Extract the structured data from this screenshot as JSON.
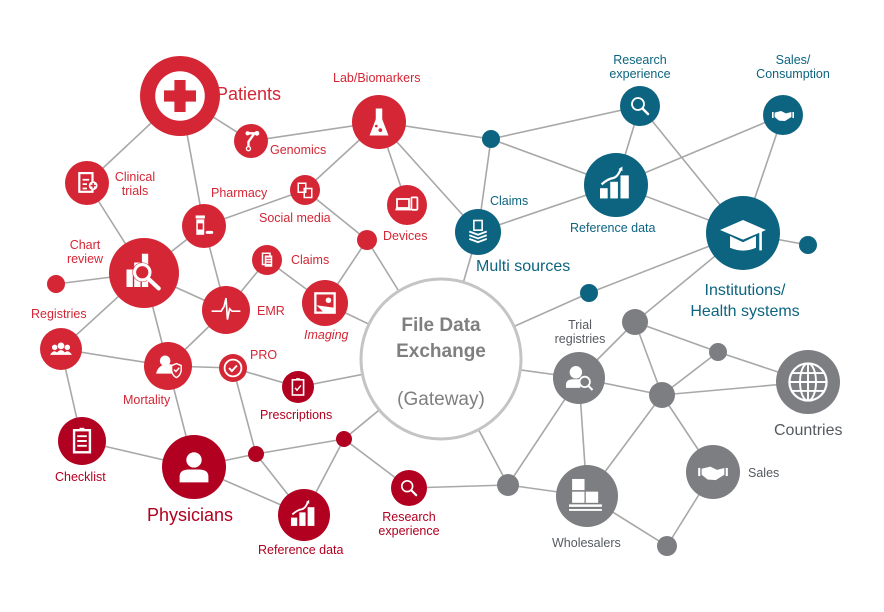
{
  "diagram": {
    "title": "File Data Exchange",
    "subtitle": "(Gateway)",
    "colors": {
      "red": "#d42635",
      "dark_red": "#b10020",
      "teal": "#0d6480",
      "gray": "#7d7e82",
      "edge": "#a8a8a8",
      "gateway_ring": "#c4c4c4"
    },
    "groups": [
      {
        "name": "patients-cluster",
        "color": "red",
        "nodes": [
          {
            "id": "patients",
            "label": "Patients",
            "icon": "medical-cross-icon"
          },
          {
            "id": "genomics",
            "label": "Genomics",
            "icon": "genomics-icon"
          },
          {
            "id": "lab-biomarkers",
            "label": "Lab/Biomarkers",
            "icon": "flask-icon"
          },
          {
            "id": "clinical-trials",
            "label": "Clinical\ntrials",
            "icon": "clipboard-plus-icon"
          },
          {
            "id": "pharmacy",
            "label": "Pharmacy",
            "icon": "pill-bottle-icon"
          },
          {
            "id": "social-media",
            "label": "Social media",
            "icon": "devices-share-icon"
          },
          {
            "id": "devices",
            "label": "Devices",
            "icon": "laptop-phone-icon"
          },
          {
            "id": "chart-review",
            "label": "Chart\nreview",
            "icon": "chart-magnifier-icon"
          },
          {
            "id": "claims-red",
            "label": "Claims",
            "icon": "document-icon"
          },
          {
            "id": "emr",
            "label": "EMR",
            "icon": "heartbeat-icon"
          },
          {
            "id": "imaging",
            "label": "Imaging",
            "icon": "image-icon"
          },
          {
            "id": "registries",
            "label": "Registries",
            "icon": "group-icon"
          },
          {
            "id": "mortality",
            "label": "Mortality",
            "icon": "user-shield-icon"
          },
          {
            "id": "pro",
            "label": "PRO",
            "icon": "check-circle-icon"
          }
        ]
      },
      {
        "name": "physicians-cluster",
        "color": "dark_red",
        "nodes": [
          {
            "id": "physicians",
            "label": "Physicians",
            "icon": "user-icon"
          },
          {
            "id": "checklist",
            "label": "Checklist",
            "icon": "checklist-icon"
          },
          {
            "id": "prescriptions",
            "label": "Prescriptions",
            "icon": "clipboard-check-icon"
          },
          {
            "id": "reference-data-red",
            "label": "Reference data",
            "icon": "growth-chart-icon"
          },
          {
            "id": "research-experience-red",
            "label": "Research\nexperience",
            "icon": "magnifier-icon"
          }
        ]
      },
      {
        "name": "institutions-cluster",
        "color": "teal",
        "nodes": [
          {
            "id": "research-experience-teal",
            "label": "Research\nexperience",
            "icon": "magnifier-icon"
          },
          {
            "id": "sales-consumption",
            "label": "Sales/\nConsumption",
            "icon": "handshake-icon"
          },
          {
            "id": "reference-data-teal",
            "label": "Reference data",
            "icon": "growth-chart-icon"
          },
          {
            "id": "multi-sources",
            "label": "Multi sources",
            "icon": "stacked-documents-icon"
          },
          {
            "id": "claims-teal",
            "label": "Claims",
            "icon": ""
          },
          {
            "id": "institutions",
            "label": "Institutions/\nHealth systems",
            "icon": "graduation-cap-icon"
          }
        ]
      },
      {
        "name": "countries-cluster",
        "color": "gray",
        "nodes": [
          {
            "id": "trial-registries",
            "label": "Trial\nregistries",
            "icon": "user-search-icon"
          },
          {
            "id": "countries",
            "label": "Countries",
            "icon": "globe-icon"
          },
          {
            "id": "sales",
            "label": "Sales",
            "icon": "handshake-icon"
          },
          {
            "id": "wholesalers",
            "label": "Wholesalers",
            "icon": "boxes-pallet-icon"
          }
        ]
      }
    ]
  }
}
